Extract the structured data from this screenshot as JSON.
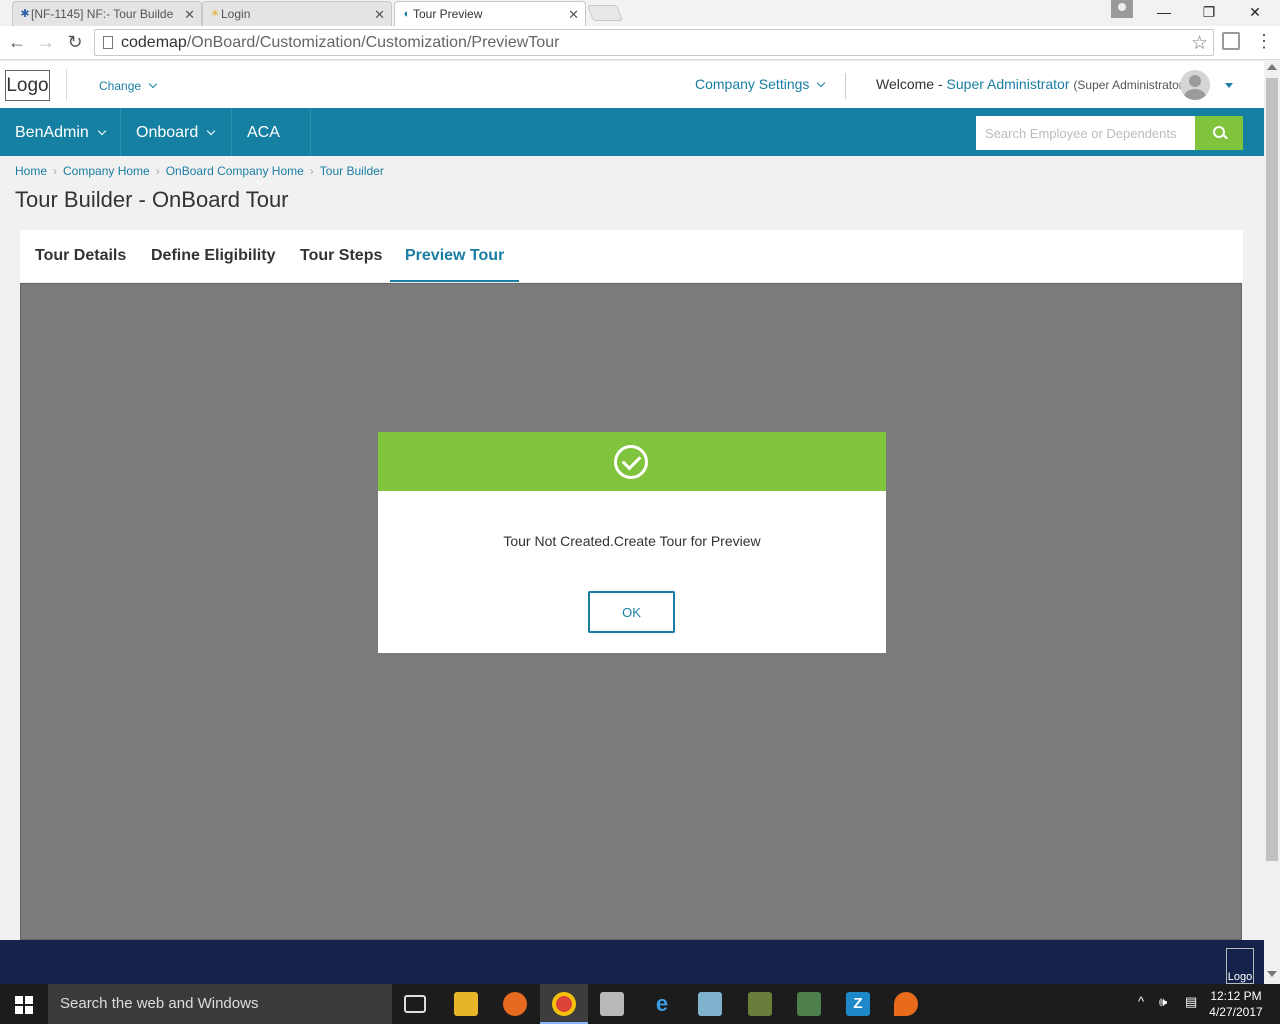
{
  "browser": {
    "tabs": [
      {
        "title": "[NF-1145] NF:- Tour Builde",
        "icon": "jira-icon"
      },
      {
        "title": "Login",
        "icon": "sun-icon"
      },
      {
        "title": "Tour Preview",
        "icon": "app-icon",
        "active": true
      }
    ],
    "url_host": "codemap",
    "url_path": "/OnBoard/Customization/Customization/PreviewTour"
  },
  "header": {
    "logo": "Logo",
    "change_label": "Change",
    "company_settings": "Company Settings",
    "welcome": "Welcome -",
    "username": "Super Administrator",
    "role": "(Super Administrator)"
  },
  "nav": {
    "items": [
      "BenAdmin",
      "Onboard",
      "ACA"
    ],
    "search_placeholder": "Search Employee or Dependents"
  },
  "breadcrumb": [
    "Home",
    "Company Home",
    "OnBoard Company Home",
    "Tour Builder"
  ],
  "page_title": "Tour Builder - OnBoard Tour",
  "tabs": [
    {
      "label": "Tour Details",
      "active": false
    },
    {
      "label": "Define Eligibility",
      "active": false
    },
    {
      "label": "Tour Steps",
      "active": false
    },
    {
      "label": "Preview Tour",
      "active": true
    }
  ],
  "modal": {
    "message": "Tour Not Created.Create Tour for Preview",
    "ok_label": "OK",
    "icon": "check-circle-icon"
  },
  "footer": {
    "logo": "Logo"
  },
  "taskbar": {
    "search_text": "Search the web and Windows",
    "time": "12:12 PM",
    "date": "4/27/2017"
  },
  "colors": {
    "primary": "#1680a3",
    "success": "#80c43e",
    "footer": "#15234a",
    "overlay": "#7b7b7b"
  }
}
